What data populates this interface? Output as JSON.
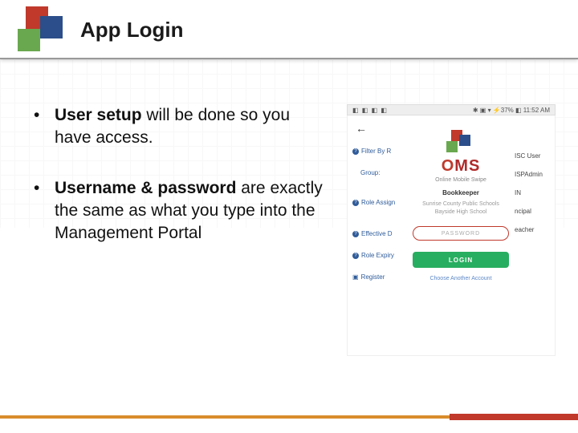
{
  "header": {
    "title": "App Login"
  },
  "bullets": [
    {
      "bold": "User setup",
      "rest": " will be done so you have access."
    },
    {
      "bold": "Username & password",
      "rest": " are exactly the same as what you type into the Management Portal"
    }
  ],
  "phone": {
    "status_left": "◧ ◧ ◧ ◧",
    "status_right": "✱ ▣ ▾ ⚡37% ◧ 11:52 AM",
    "back": "←",
    "side_labels": {
      "filter": "Filter By R",
      "group": "Group:",
      "role_assign": "Role Assign",
      "effective": "Effective D",
      "role_expiry": "Role Expiry",
      "register": "Register"
    },
    "right_labels": [
      "ISC User",
      "ISPAdmin",
      "IN",
      "ncipal",
      "eacher"
    ],
    "brand_initial": "O",
    "brand_rest": "MS",
    "tagline": "Online Mobile Swipe",
    "account": "Bookkeeper",
    "sub1": "Sunrise County Public Schools",
    "sub2": "Bayside High School",
    "password_placeholder": "PASSWORD",
    "login_label": "LOGIN",
    "choose": "Choose Another Account"
  }
}
